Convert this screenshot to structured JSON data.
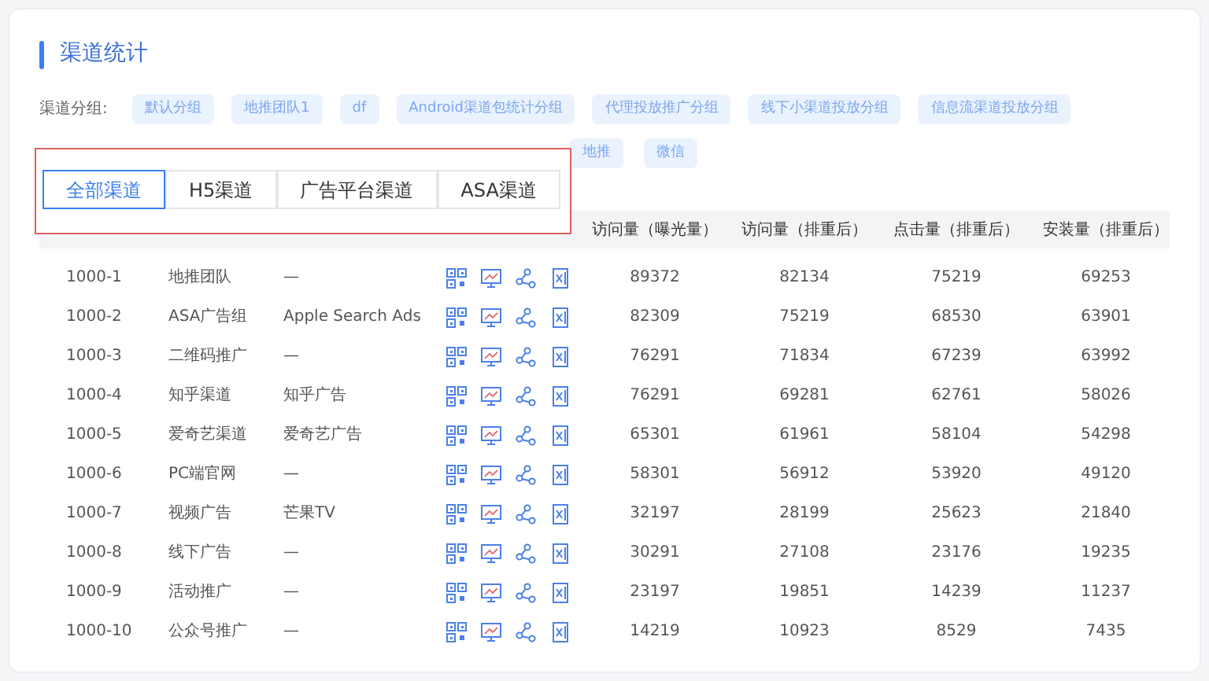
{
  "title": "渠道统计",
  "group_label": "渠道分组:",
  "groups_row1": [
    "默认分组",
    "地推团队1",
    "df",
    "Android渠道包统计分组",
    "代理投放推广分组",
    "线下小渠道投放分组",
    "信息流渠道投放分组"
  ],
  "groups_row2": [
    "地推",
    "微信"
  ],
  "tabs": [
    {
      "label": "全部渠道",
      "selected": true
    },
    {
      "label": "H5渠道",
      "selected": false
    },
    {
      "label": "广告平台渠道",
      "selected": false
    },
    {
      "label": "ASA渠道",
      "selected": false
    }
  ],
  "table": {
    "columns": [
      "访问量（曝光量）",
      "访问量（排重后）",
      "点击量（排重后）",
      "安装量（排重后）"
    ],
    "rows": [
      {
        "id": "1000-1",
        "name": "地推团队",
        "media": "—",
        "values": [
          "89372",
          "82134",
          "75219",
          "69253"
        ]
      },
      {
        "id": "1000-2",
        "name": "ASA广告组",
        "media": "Apple Search Ads",
        "values": [
          "82309",
          "75219",
          "68530",
          "63901"
        ]
      },
      {
        "id": "1000-3",
        "name": "二维码推广",
        "media": "—",
        "values": [
          "76291",
          "71834",
          "67239",
          "63992"
        ]
      },
      {
        "id": "1000-4",
        "name": "知乎渠道",
        "media": "知乎广告",
        "values": [
          "76291",
          "69281",
          "62761",
          "58026"
        ]
      },
      {
        "id": "1000-5",
        "name": "爱奇艺渠道",
        "media": "爱奇艺广告",
        "values": [
          "65301",
          "61961",
          "58104",
          "54298"
        ]
      },
      {
        "id": "1000-6",
        "name": "PC端官网",
        "media": "—",
        "values": [
          "58301",
          "56912",
          "53920",
          "49120"
        ]
      },
      {
        "id": "1000-7",
        "name": "视频广告",
        "media": "芒果TV",
        "values": [
          "32197",
          "28199",
          "25623",
          "21840"
        ]
      },
      {
        "id": "1000-8",
        "name": "线下广告",
        "media": "—",
        "values": [
          "30291",
          "27108",
          "23176",
          "19235"
        ]
      },
      {
        "id": "1000-9",
        "name": "活动推广",
        "media": "—",
        "values": [
          "23197",
          "19851",
          "14239",
          "11237"
        ]
      },
      {
        "id": "1000-10",
        "name": "公众号推广",
        "media": "—",
        "values": [
          "14219",
          "10923",
          "8529",
          "7435"
        ]
      }
    ]
  }
}
